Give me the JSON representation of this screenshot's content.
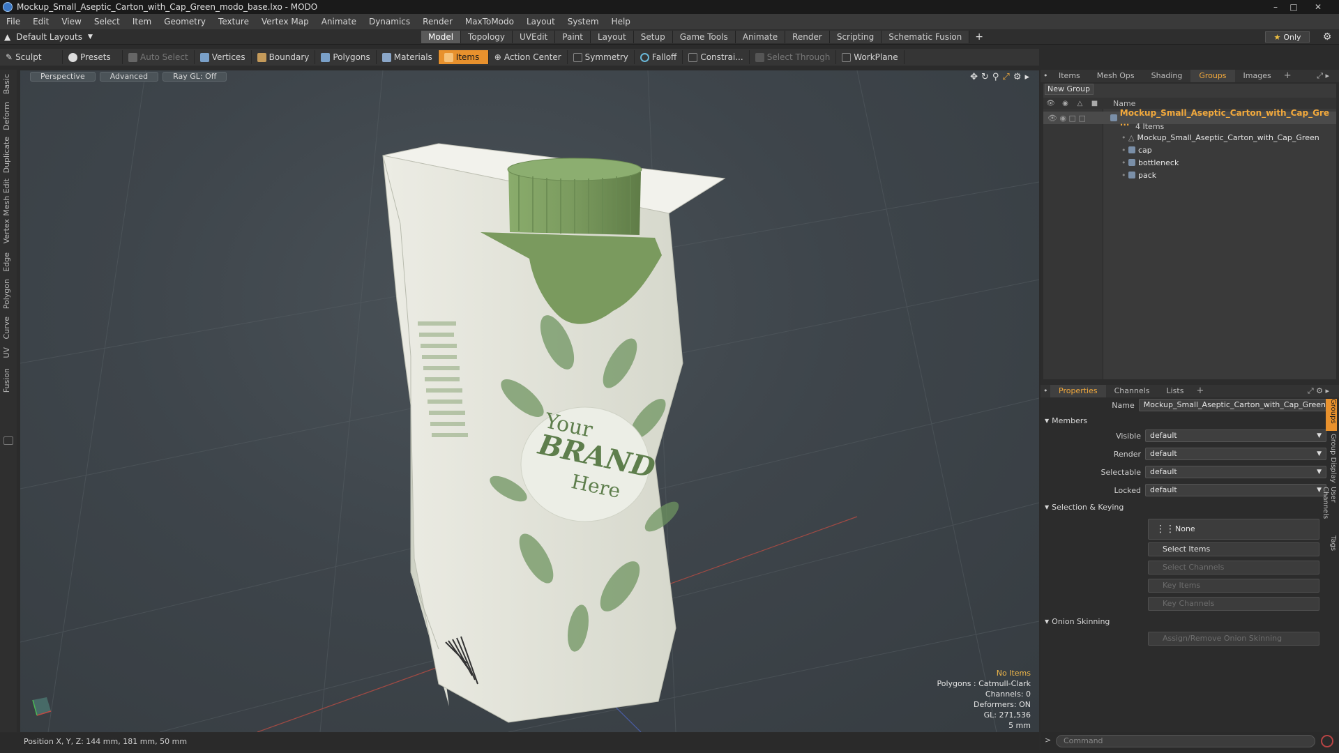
{
  "window": {
    "title": "Mockup_Small_Aseptic_Carton_with_Cap_Green_modo_base.lxo - MODO",
    "controls": [
      "minimize-icon",
      "maximize-icon",
      "close-icon"
    ]
  },
  "menu": [
    "File",
    "Edit",
    "View",
    "Select",
    "Item",
    "Geometry",
    "Texture",
    "Vertex Map",
    "Animate",
    "Dynamics",
    "Render",
    "MaxToModo",
    "Layout",
    "System",
    "Help"
  ],
  "layouts": {
    "dropdown": "Default Layouts",
    "tabs": [
      "Model",
      "Topology",
      "UVEdit",
      "Paint",
      "Layout",
      "Setup",
      "Game Tools",
      "Animate",
      "Render",
      "Scripting",
      "Schematic Fusion"
    ],
    "active_tab": "Model",
    "only_label": "Only"
  },
  "toolbar": {
    "sculpt": "Sculpt",
    "presets": "Presets",
    "auto_select": "Auto Select",
    "vertices": "Vertices",
    "boundary": "Boundary",
    "polygons": "Polygons",
    "materials": "Materials",
    "items": "Items",
    "action_center": "Action Center",
    "symmetry": "Symmetry",
    "falloff": "Falloff",
    "constrain": "Constrai...",
    "select_through": "Select Through",
    "workplane": "WorkPlane"
  },
  "left_tabs": [
    "Basic",
    "Deform",
    "Duplicate",
    "Mesh Edit",
    "Vertex",
    "Edge",
    "Polygon",
    "Curve",
    "UV",
    "Fusion"
  ],
  "viewport": {
    "buttons": [
      "Perspective",
      "Advanced",
      "Ray GL: Off"
    ],
    "stats": {
      "selection": "No Items",
      "polygons": "Polygons : Catmull-Clark",
      "channels": "Channels: 0",
      "deformers": "Deformers: ON",
      "gl": "GL: 271,536",
      "scale": "5 mm"
    },
    "label_art": {
      "line1": "Your",
      "line2": "BRAND",
      "line3": "Here"
    }
  },
  "statusbar": {
    "position": "Position X, Y, Z:  144 mm, 181 mm, 50 mm"
  },
  "groups_panel": {
    "tabs": [
      "Items",
      "Mesh Ops",
      "Shading",
      "Groups",
      "Images"
    ],
    "active_tab": "Groups",
    "new_group": "New Group",
    "name_header": "Name",
    "group_name": "Mockup_Small_Aseptic_Carton_with_Cap_Gre ...",
    "group_count": "4 Items",
    "children": [
      "Mockup_Small_Aseptic_Carton_with_Cap_Green",
      "cap",
      "bottleneck",
      "pack"
    ]
  },
  "properties": {
    "tabs": [
      "Properties",
      "Channels",
      "Lists"
    ],
    "active_tab": "Properties",
    "name_label": "Name",
    "name_value": "Mockup_Small_Aseptic_Carton_with_Cap_Green",
    "members_section": "Members",
    "visible_label": "Visible",
    "visible_value": "default",
    "render_label": "Render",
    "render_value": "default",
    "selectable_label": "Selectable",
    "selectable_value": "default",
    "locked_label": "Locked",
    "locked_value": "default",
    "selection_section": "Selection & Keying",
    "none_label": "None",
    "select_items": "Select Items",
    "select_channels": "Select Channels",
    "key_items": "Key Items",
    "key_channels": "Key Channels",
    "onion_section": "Onion Skinning",
    "onion_button": "Assign/Remove Onion Skinning",
    "side_tabs": [
      "Groups",
      "Group Display",
      "User Channels",
      "Tags"
    ]
  },
  "command": {
    "placeholder": "Command"
  },
  "colors": {
    "accent": "#e8912d",
    "selection_orange": "#f2a93c",
    "cap_green": "#7a9a5e"
  }
}
